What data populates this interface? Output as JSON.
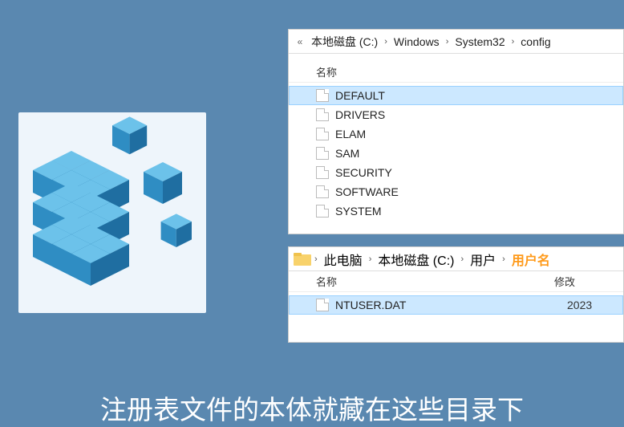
{
  "explorer_top": {
    "breadcrumb": {
      "ellipsis": "«",
      "parts": [
        "本地磁盘 (C:)",
        "Windows",
        "System32",
        "config"
      ]
    },
    "columns": {
      "name": "名称"
    },
    "files": [
      {
        "name": "DEFAULT",
        "selected": true
      },
      {
        "name": "DRIVERS",
        "selected": false
      },
      {
        "name": "ELAM",
        "selected": false
      },
      {
        "name": "SAM",
        "selected": false
      },
      {
        "name": "SECURITY",
        "selected": false
      },
      {
        "name": "SOFTWARE",
        "selected": false
      },
      {
        "name": "SYSTEM",
        "selected": false
      }
    ]
  },
  "explorer_bottom": {
    "breadcrumb": {
      "parts": [
        "此电脑",
        "本地磁盘 (C:)",
        "用户"
      ],
      "user_label": "用户名"
    },
    "columns": {
      "name": "名称",
      "date": "修改"
    },
    "files": [
      {
        "name": "NTUSER.DAT",
        "selected": true,
        "date": "2023"
      }
    ]
  },
  "caption": "注册表文件的本体就藏在这些目录下",
  "icon_semantic": "registry-cube-icon"
}
